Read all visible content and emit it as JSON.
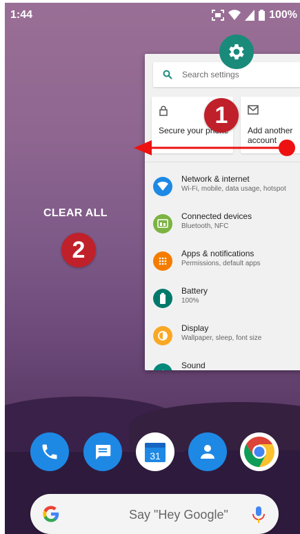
{
  "status_bar": {
    "time": "1:44",
    "battery": "100%"
  },
  "recents": {
    "clear_all_label": "CLEAR ALL",
    "annotation_1": "1",
    "annotation_2": "2"
  },
  "settings_card": {
    "search_placeholder": "Search settings",
    "suggestions": [
      {
        "label": "Secure your phone",
        "icon": "lock-icon"
      },
      {
        "label": "Add another account",
        "icon": "mail-icon"
      }
    ],
    "items": [
      {
        "title": "Network & internet",
        "subtitle": "Wi-Fi, mobile, data usage, hotspot",
        "icon": "wifi-icon",
        "color": "#1e88e5"
      },
      {
        "title": "Connected devices",
        "subtitle": "Bluetooth, NFC",
        "icon": "devices-icon",
        "color": "#7cb342"
      },
      {
        "title": "Apps & notifications",
        "subtitle": "Permissions, default apps",
        "icon": "apps-icon",
        "color": "#f57c00"
      },
      {
        "title": "Battery",
        "subtitle": "100%",
        "icon": "battery-icon",
        "color": "#00796b"
      },
      {
        "title": "Display",
        "subtitle": "Wallpaper, sleep, font size",
        "icon": "display-icon",
        "color": "#f9a825"
      },
      {
        "title": "Sound",
        "subtitle": "",
        "icon": "sound-icon",
        "color": "#00897b"
      }
    ]
  },
  "dock": {
    "apps": [
      {
        "name": "Phone",
        "icon": "phone-icon",
        "color": "#1e88e5"
      },
      {
        "name": "Messages",
        "icon": "messages-icon",
        "color": "#1e88e5"
      },
      {
        "name": "Calendar",
        "icon": "calendar-icon",
        "date": "31",
        "color": "#ffffff"
      },
      {
        "name": "Contacts",
        "icon": "contacts-icon",
        "color": "#1e88e5"
      },
      {
        "name": "Chrome",
        "icon": "chrome-icon",
        "color": "#ffffff"
      }
    ]
  },
  "google_bar": {
    "hint": "Say \"Hey Google\""
  }
}
